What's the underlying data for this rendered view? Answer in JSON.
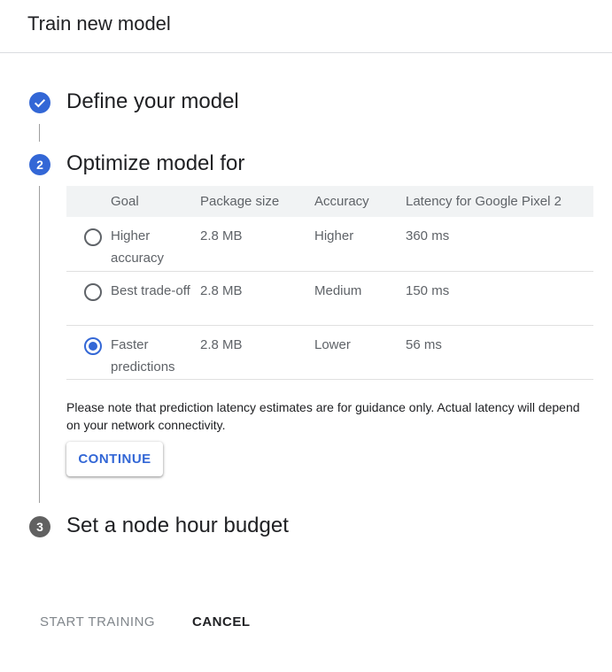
{
  "header": {
    "title": "Train new model"
  },
  "steps": [
    {
      "number": "1",
      "state": "done",
      "title": "Define your model"
    },
    {
      "number": "2",
      "state": "active",
      "title": "Optimize model for"
    },
    {
      "number": "3",
      "state": "pending",
      "title": "Set a node hour budget"
    }
  ],
  "table": {
    "columns": [
      "Goal",
      "Package size",
      "Accuracy",
      "Latency for Google Pixel 2"
    ],
    "rows": [
      {
        "goal": "Higher accuracy",
        "package_size": "2.8 MB",
        "accuracy": "Higher",
        "latency": "360 ms",
        "selected": false
      },
      {
        "goal": "Best trade-off",
        "package_size": "2.8 MB",
        "accuracy": "Medium",
        "latency": "150 ms",
        "selected": false
      },
      {
        "goal": "Faster predictions",
        "package_size": "2.8 MB",
        "accuracy": "Lower",
        "latency": "56 ms",
        "selected": true
      }
    ]
  },
  "note": "Please note that prediction latency estimates are for guidance only. Actual latency will depend on your network connectivity.",
  "continue_label": "CONTINUE",
  "footer": {
    "start_label": "START TRAINING",
    "cancel_label": "CANCEL"
  },
  "colors": {
    "accent": "#3367d6",
    "pending": "#616161",
    "disabled": "#80868b"
  },
  "icons": {
    "step1": "check-icon"
  }
}
